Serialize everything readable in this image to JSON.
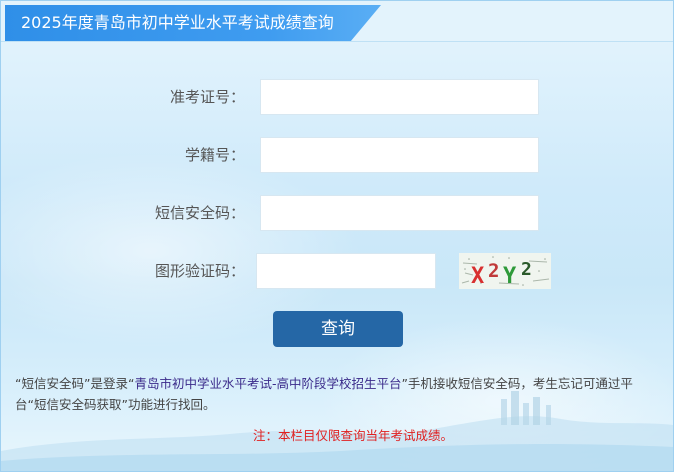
{
  "header": {
    "title": "2025年度青岛市初中学业水平考试成绩查询"
  },
  "form": {
    "fields": [
      {
        "label": "准考证号：",
        "value": "",
        "placeholder": ""
      },
      {
        "label": "学籍号：",
        "value": "",
        "placeholder": ""
      },
      {
        "label": "短信安全码：",
        "value": "",
        "placeholder": ""
      },
      {
        "label": "图形验证码：",
        "value": "",
        "placeholder": ""
      }
    ],
    "captcha_text": "X2Y2",
    "submit_label": "查询"
  },
  "note": {
    "part1": "“短信安全码”是登录“",
    "platform_name": "青岛市初中学业水平考试-高中阶段学校招生平台",
    "part2": "”手机接收短信安全码，考生忘记可通过平台“短信安全码获取”功能进行找回。"
  },
  "notice": "注：本栏目仅限查询当年考试成绩。",
  "colors": {
    "title_tab": "#3f9cf0",
    "button": "#2567a6",
    "notice_text": "#e02020",
    "platform_link": "#3a2a8a"
  }
}
